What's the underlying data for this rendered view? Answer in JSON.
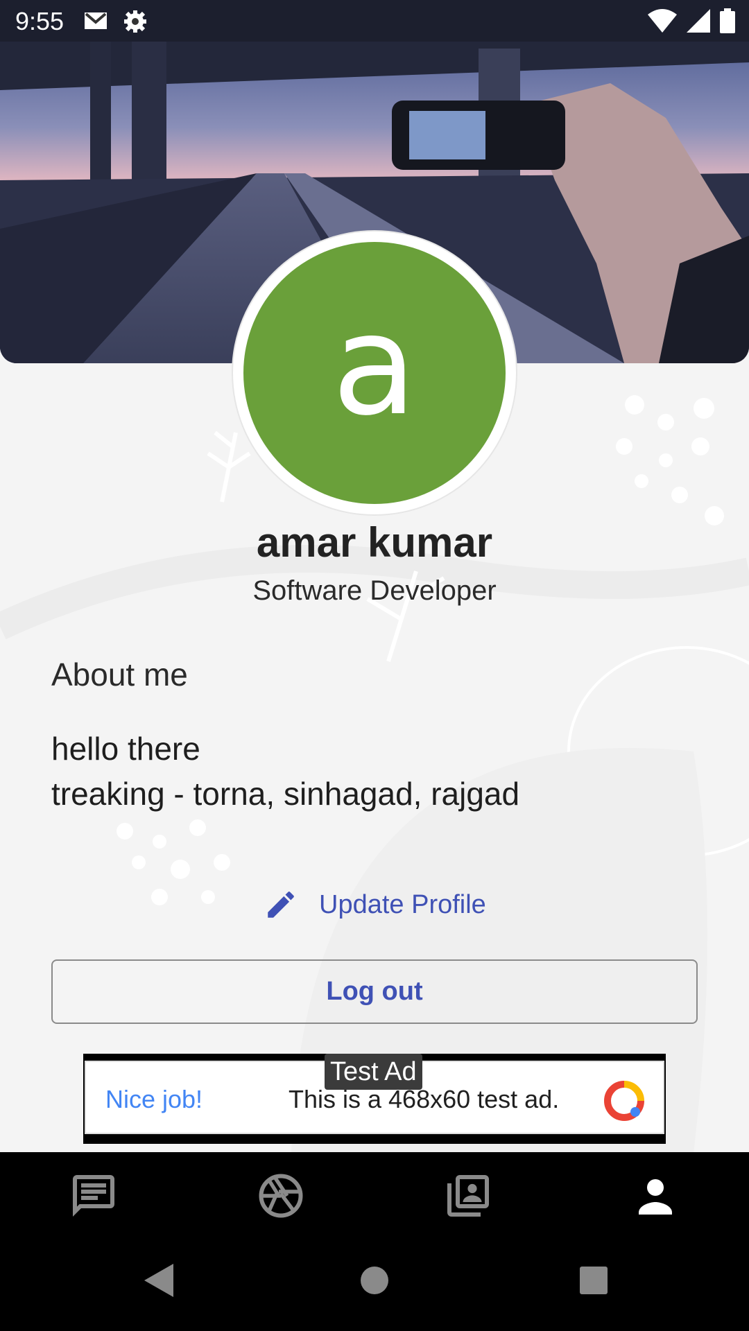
{
  "status_bar": {
    "time": "9:55",
    "icons_left": [
      "gmail-icon",
      "settings-icon"
    ],
    "icons_right": [
      "wifi-icon",
      "signal-icon",
      "battery-icon"
    ]
  },
  "profile": {
    "avatar_letter": "a",
    "avatar_color": "#6aa03a",
    "name": "amar kumar",
    "title": "Software Developer"
  },
  "about": {
    "heading": "About me",
    "line1": "hello there",
    "line2": "treaking - torna, sinhagad, rajgad"
  },
  "actions": {
    "update_label": "Update Profile",
    "logout_label": "Log out",
    "accent": "#3f51b5"
  },
  "ad": {
    "badge": "Test Ad",
    "headline": "Nice job!",
    "text": "This is a 468x60 test ad."
  },
  "bottom_nav": {
    "items": [
      "chat-icon",
      "camera-shutter-icon",
      "photo-library-icon",
      "person-icon"
    ],
    "selected": "person-icon"
  },
  "system_nav": [
    "back-icon",
    "home-icon",
    "recents-icon"
  ]
}
